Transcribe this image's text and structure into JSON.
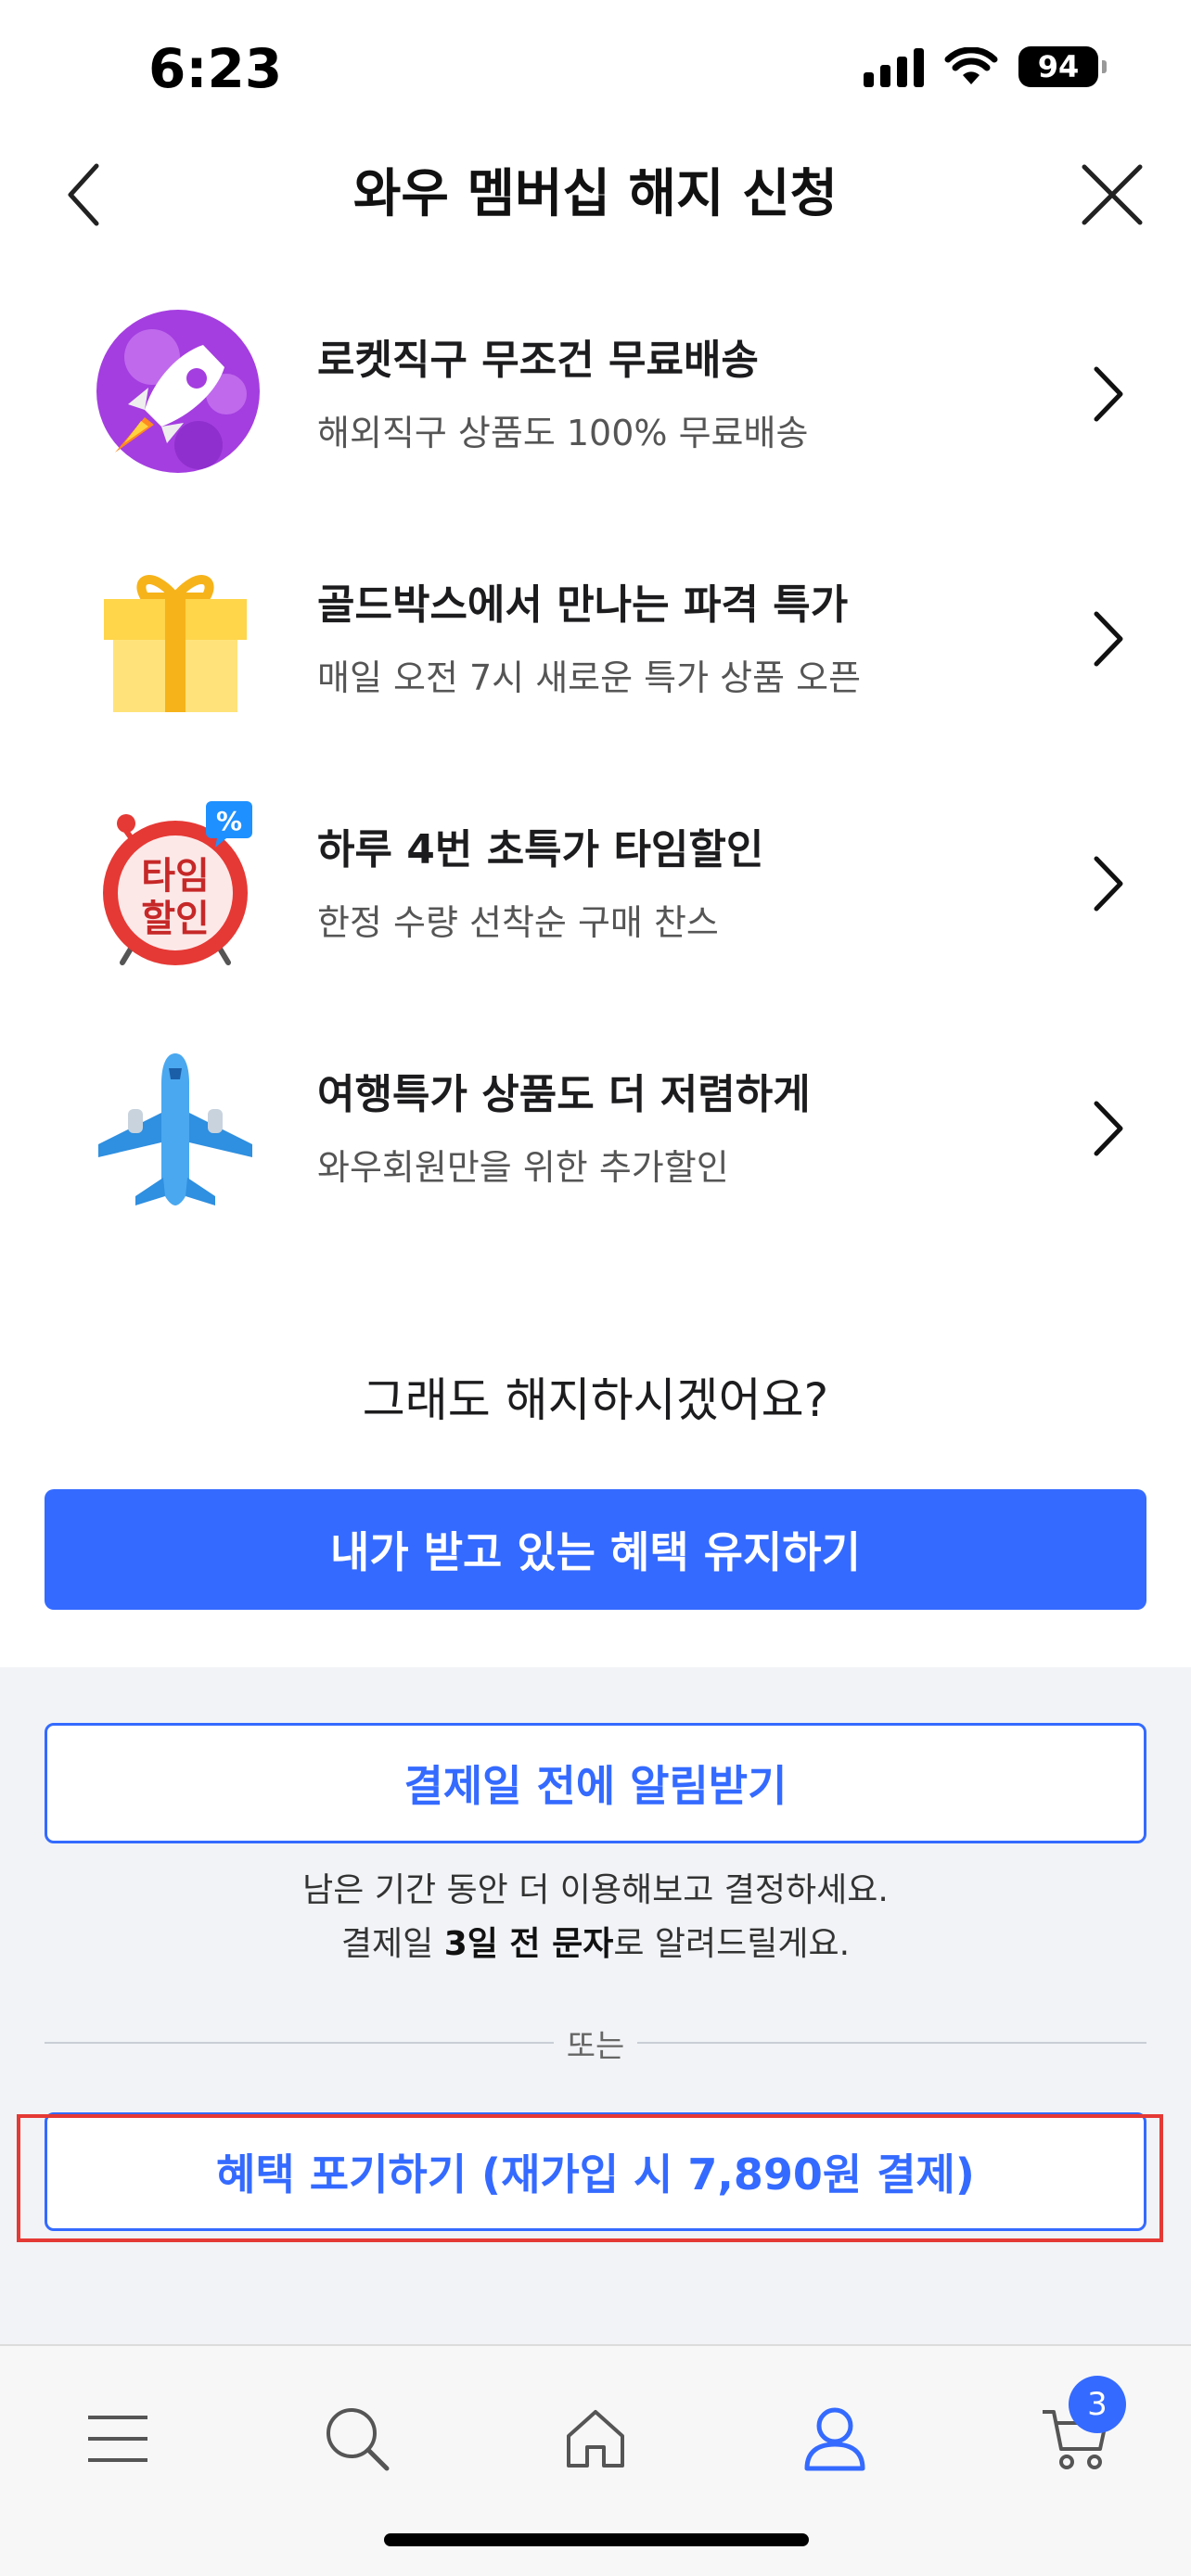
{
  "status_bar": {
    "time": "6:23",
    "battery": "94"
  },
  "header": {
    "title": "와우 멤버십 해지 신청"
  },
  "benefits": [
    {
      "title": "로켓직구 무조건 무료배송",
      "description": "해외직구 상품도 100% 무료배송",
      "icon": "rocket-icon"
    },
    {
      "title": "골드박스에서 만나는 파격 특가",
      "description": "매일 오전 7시 새로운 특가 상품 오픈",
      "icon": "gift-box-icon"
    },
    {
      "title": "하루 4번 초특가 타임할인",
      "description": "한정 수량 선착순 구매 찬스",
      "icon": "alarm-clock-icon",
      "icon_text_line1": "타임",
      "icon_text_line2": "할인",
      "icon_badge": "%"
    },
    {
      "title": "여행특가 상품도 더 저렴하게",
      "description": "와우회원만을 위한 추가할인",
      "icon": "airplane-icon"
    }
  ],
  "question": "그래도 해지하시겠어요?",
  "keep_button": "내가 받고 있는 혜택 유지하기",
  "notify": {
    "button": "결제일 전에 알림받기",
    "desc_line1": "남은 기간 동안 더 이용해보고 결정하세요.",
    "desc_line2_prefix": "결제일 ",
    "desc_line2_bold": "3일 전 문자",
    "desc_line2_suffix": "로 알려드릴게요."
  },
  "or_text": "또는",
  "giveup_button": "혜택 포기하기 (재가입 시 7,890원 결제)",
  "tab_bar": {
    "cart_badge": "3",
    "active_tab": "my-page"
  },
  "colors": {
    "primary": "#346aff",
    "highlight": "#e53935",
    "grey_bg": "#f1f3f6"
  }
}
